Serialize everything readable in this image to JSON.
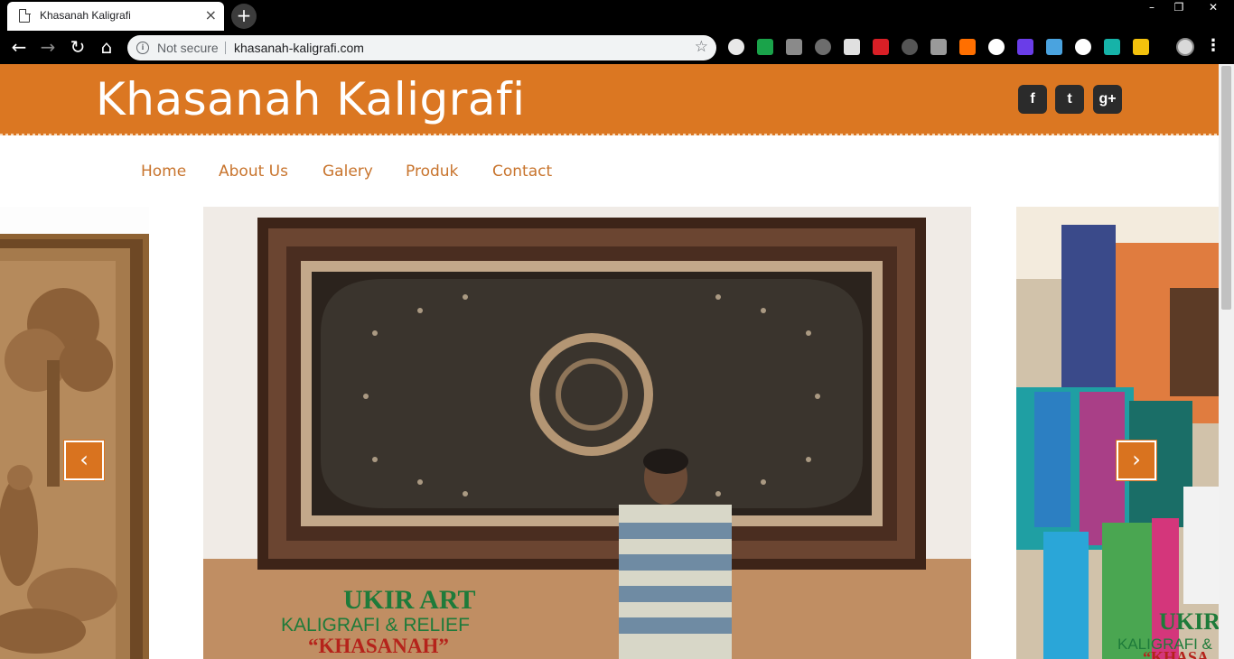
{
  "browser": {
    "tab_title": "Khasanah Kaligrafi",
    "tab_close": "×",
    "new_tab": "+",
    "window_controls": [
      "–",
      "❐",
      "✕"
    ],
    "back_icon": "←",
    "forward_icon": "→",
    "reload_icon": "↻",
    "home_icon": "⌂",
    "security_label": "Not secure",
    "url": "khasanah-kaligrafi.com",
    "bookmark_icon": "☆",
    "menu_icon": "⋮",
    "extension_colors": [
      "#e8e8e8",
      "#1aa34a",
      "#8a8a8a",
      "#6d6d6d",
      "#e0e0e0",
      "#d91f26",
      "#555555",
      "#9a9a9a",
      "#ff6f00",
      "#ffffff",
      "#6a3de8",
      "#4aa3df",
      "#ffffff",
      "#16b3a8",
      "#f4c20d"
    ]
  },
  "site": {
    "brand": "Khasanah Kaligrafi",
    "social": {
      "facebook": "f",
      "twitter": "t",
      "googleplus": "g+"
    },
    "nav": [
      "Home",
      "About Us",
      "Galery",
      "Produk",
      "Contact"
    ],
    "slider": {
      "prev": "‹",
      "next": "›",
      "center_caption": [
        "UKIR ART",
        "KALIGRAFI & RELIEF",
        "“KHASANAH”"
      ],
      "right_caption": "UKIR",
      "right_caption_sub": "KALIGRAFI &",
      "right_caption_quote": "“KHASA"
    },
    "colors": {
      "header": "#db7722",
      "nav_text": "#c8742d",
      "arrow": "#d9731f"
    }
  }
}
